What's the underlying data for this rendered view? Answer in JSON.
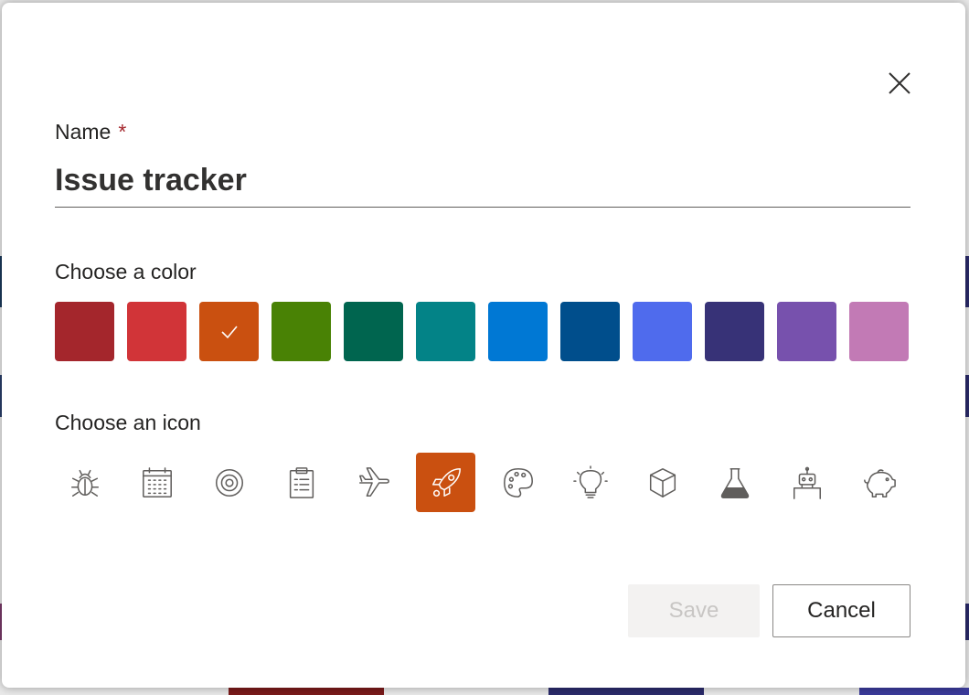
{
  "dialog": {
    "name_label": "Name",
    "required_marker": "*",
    "name_value": "Issue tracker",
    "color_label": "Choose a color",
    "icon_label": "Choose an icon",
    "save_label": "Save",
    "cancel_label": "Cancel",
    "close_icon": "close-icon"
  },
  "colors": [
    {
      "hex": "#a4262c",
      "selected": false
    },
    {
      "hex": "#d13438",
      "selected": false
    },
    {
      "hex": "#ca5010",
      "selected": true
    },
    {
      "hex": "#498205",
      "selected": false
    },
    {
      "hex": "#00654f",
      "selected": false
    },
    {
      "hex": "#038387",
      "selected": false
    },
    {
      "hex": "#0078d4",
      "selected": false
    },
    {
      "hex": "#004e8c",
      "selected": false
    },
    {
      "hex": "#4f6bed",
      "selected": false
    },
    {
      "hex": "#373277",
      "selected": false
    },
    {
      "hex": "#7751ad",
      "selected": false
    },
    {
      "hex": "#c27ab5",
      "selected": false
    }
  ],
  "icons": [
    {
      "name": "bug-icon",
      "selected": false
    },
    {
      "name": "calendar-icon",
      "selected": false
    },
    {
      "name": "target-icon",
      "selected": false
    },
    {
      "name": "clipboard-icon",
      "selected": false
    },
    {
      "name": "airplane-icon",
      "selected": false
    },
    {
      "name": "rocket-icon",
      "selected": true
    },
    {
      "name": "palette-icon",
      "selected": false
    },
    {
      "name": "lightbulb-icon",
      "selected": false
    },
    {
      "name": "cube-icon",
      "selected": false
    },
    {
      "name": "flask-icon",
      "selected": false
    },
    {
      "name": "robot-icon",
      "selected": false
    },
    {
      "name": "piggy-bank-icon",
      "selected": false
    }
  ],
  "theme": {
    "selected_icon_bg": "#ca5010",
    "icon_stroke": "#605e5c",
    "selected_icon_stroke": "#ffffff"
  }
}
